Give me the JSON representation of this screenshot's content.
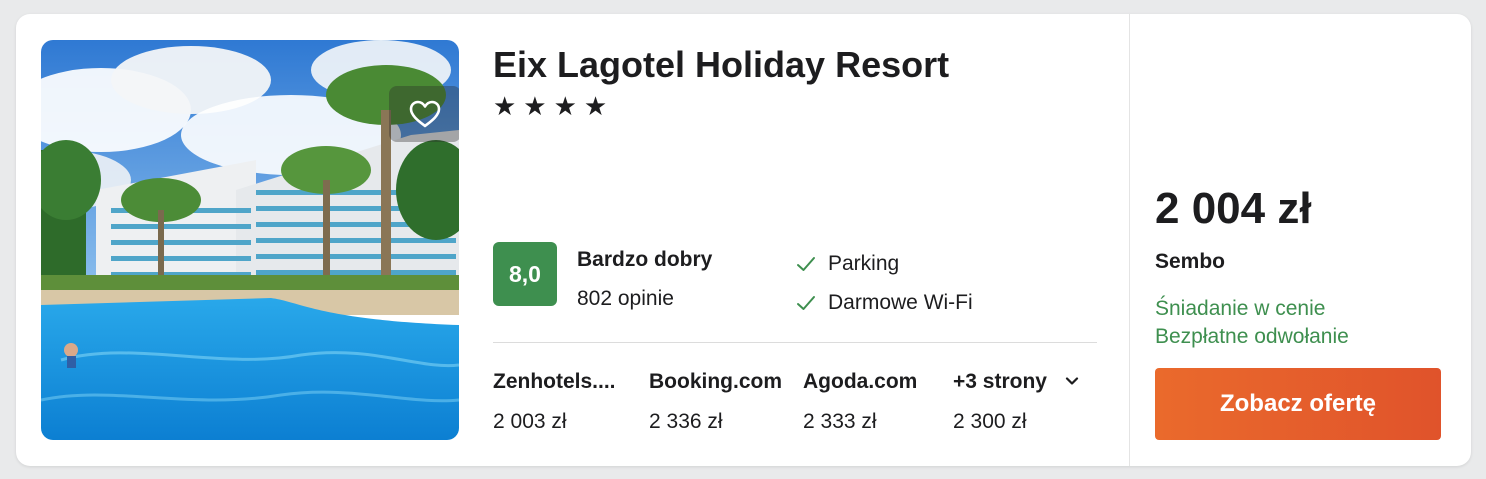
{
  "hotel": {
    "name": "Eix Lagotel Holiday Resort",
    "stars": "★★★★",
    "star_count": 4
  },
  "rating": {
    "score": "8,0",
    "label": "Bardzo dobry",
    "reviews": "802 opinie",
    "badge_color": "#3e8f4f"
  },
  "amenities": [
    {
      "label": "Parking",
      "icon": "check-icon"
    },
    {
      "label": "Darmowe Wi-Fi",
      "icon": "check-icon"
    }
  ],
  "providers": [
    {
      "name": "Zenhotels....",
      "price": "2 003 zł"
    },
    {
      "name": "Booking.com",
      "price": "2 336 zł"
    },
    {
      "name": "Agoda.com",
      "price": "2 333 zł"
    },
    {
      "name": "+3 strony",
      "price": "2 300 zł",
      "icon": "chevron-down-icon"
    }
  ],
  "offer": {
    "price": "2 004 zł",
    "provider": "Sembo",
    "perks": [
      "Śniadanie w cenie",
      "Bezpłatne odwołanie"
    ],
    "cta_label": "Zobacz ofertę",
    "perk_color": "#3e8f4f",
    "cta_color": "#e75f2b"
  },
  "favorite_icon": "heart-outline-icon"
}
